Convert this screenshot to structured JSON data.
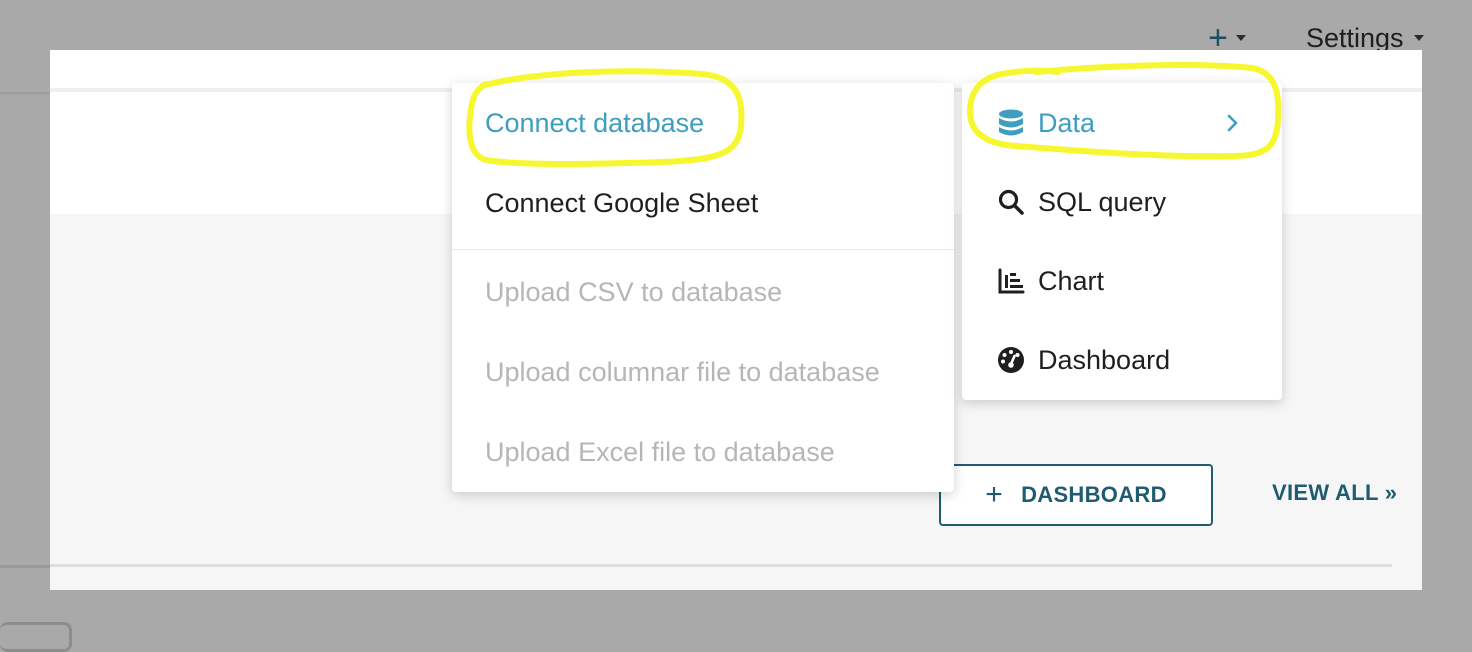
{
  "nav": {
    "add_icon": "plus-icon",
    "settings_label": "Settings"
  },
  "data_submenu": {
    "items": [
      {
        "label": "Connect database",
        "state": "active"
      },
      {
        "label": "Connect Google Sheet",
        "state": "enabled"
      },
      {
        "label": "Upload CSV to database",
        "state": "disabled"
      },
      {
        "label": "Upload columnar file to database",
        "state": "disabled"
      },
      {
        "label": "Upload Excel file to database",
        "state": "disabled"
      }
    ]
  },
  "add_menu": {
    "items": [
      {
        "label": "Data",
        "icon": "database-icon",
        "state": "active",
        "has_submenu": true
      },
      {
        "label": "SQL query",
        "icon": "search-icon",
        "state": "enabled"
      },
      {
        "label": "Chart",
        "icon": "bar-chart-icon",
        "state": "enabled"
      },
      {
        "label": "Dashboard",
        "icon": "dashboard-gauge-icon",
        "state": "enabled"
      }
    ]
  },
  "panel": {
    "add_dashboard_label": "DASHBOARD",
    "view_all_label": "VIEW ALL »"
  },
  "colors": {
    "accent": "#3f9dbf",
    "primary": "#1f5c72",
    "disabled_text": "#b6b6b6",
    "highlight_annotation": "#f6f72e",
    "overlay": "#a9a9a9"
  }
}
